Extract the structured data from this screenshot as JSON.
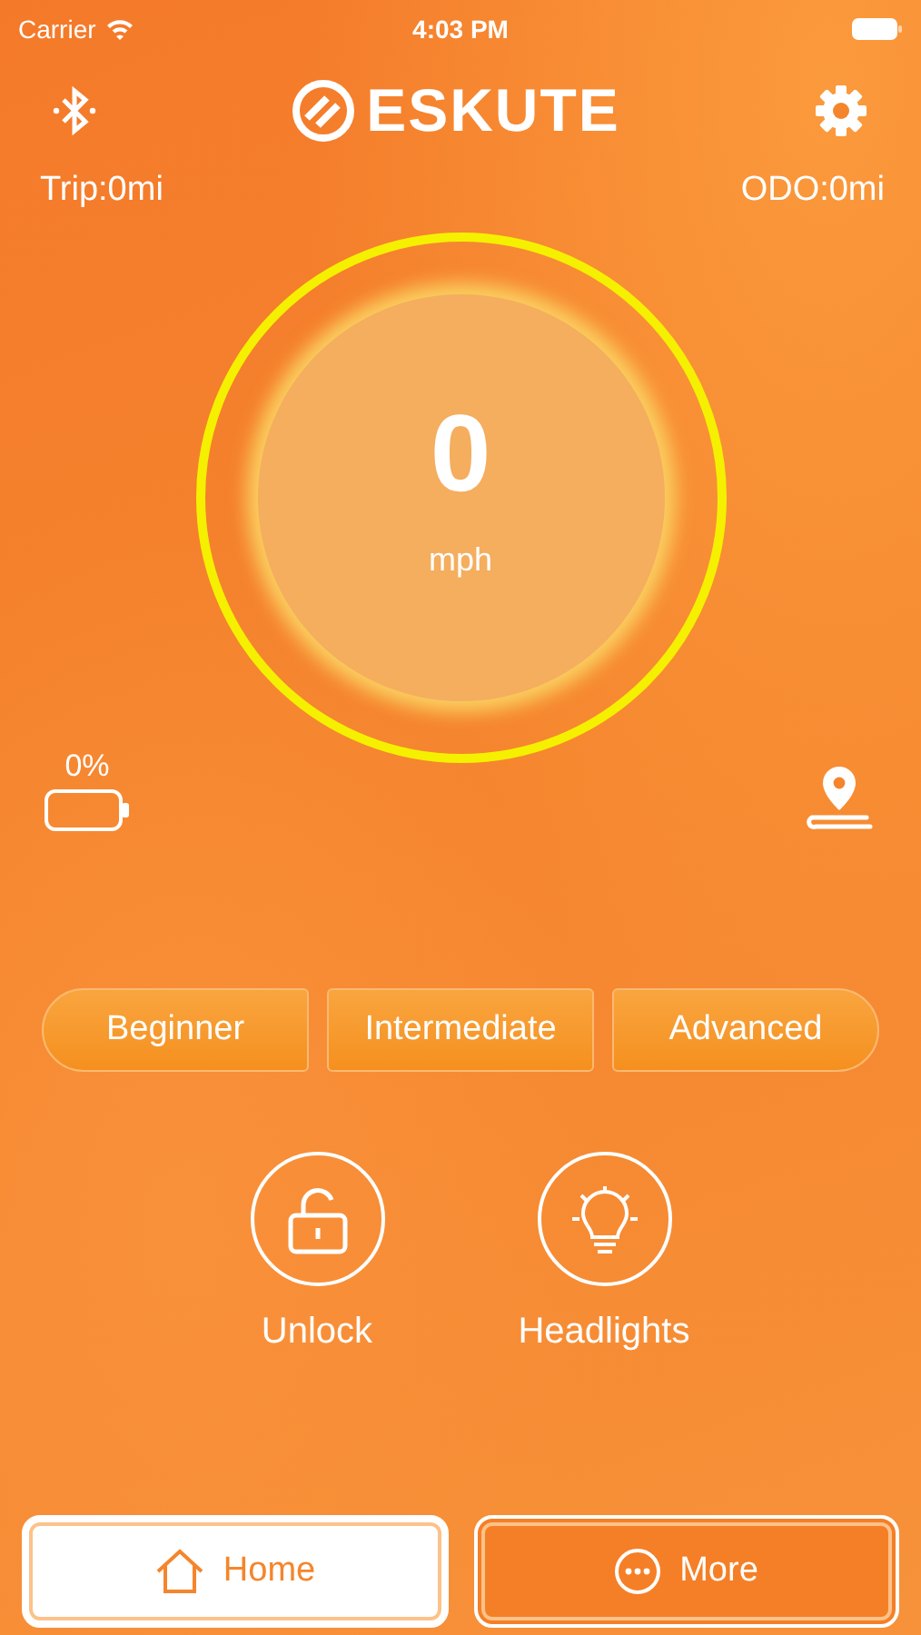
{
  "status_bar": {
    "carrier": "Carrier",
    "time": "4:03 PM"
  },
  "header": {
    "logo": "ESKUTE"
  },
  "trip": "Trip:0mi",
  "odo": "ODO:0mi",
  "speed": {
    "value": "0",
    "unit": "mph"
  },
  "battery": {
    "reading": "0%"
  },
  "modes": [
    {
      "label": "Beginner",
      "selected": false
    },
    {
      "label": "Intermediate",
      "selected": false
    },
    {
      "label": "Advanced",
      "selected": false
    }
  ],
  "actions": [
    {
      "kind": "lock",
      "label": "Unlock"
    },
    {
      "kind": "light",
      "label": "Headlights"
    }
  ],
  "tabs": [
    {
      "kind": "home",
      "label": "Home",
      "selected": true
    },
    {
      "kind": "more",
      "label": "More",
      "selected": false
    }
  ]
}
